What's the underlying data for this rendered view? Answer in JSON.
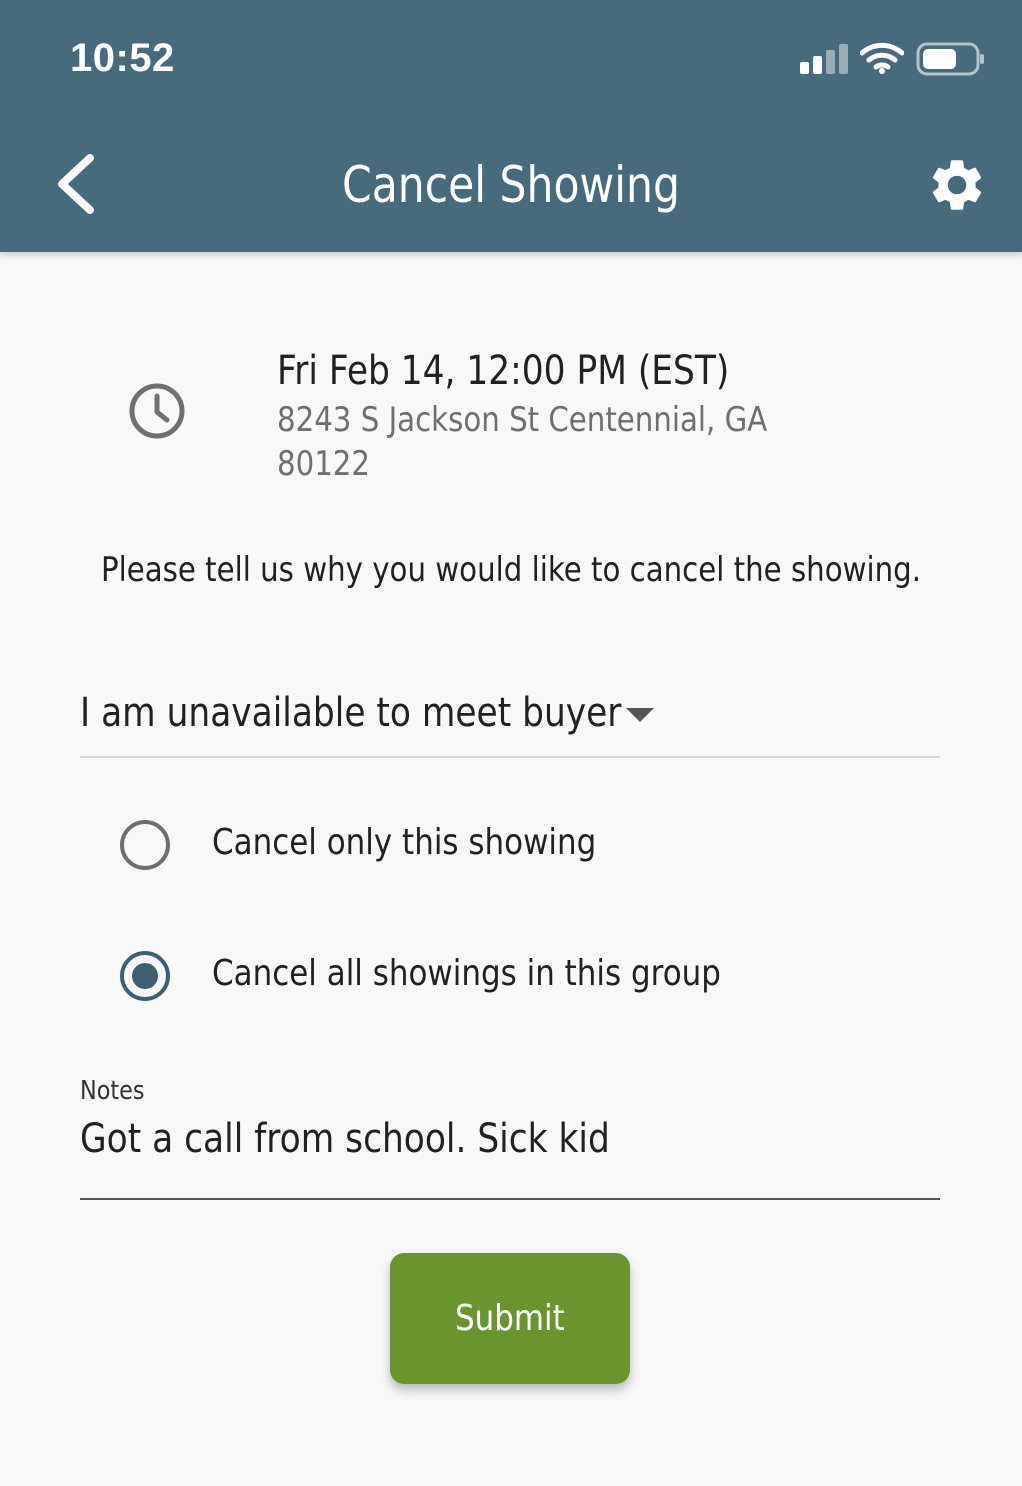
{
  "status_bar": {
    "time": "10:52"
  },
  "header": {
    "title": "Cancel Showing"
  },
  "showing": {
    "datetime": "Fri Feb 14, 12:00 PM (EST)",
    "address": "8243 S Jackson St  Centennial, GA 80122"
  },
  "prompt": "Please tell us why you would like to cancel the showing.",
  "reason_select": {
    "selected": "I am unavailable to meet buyer"
  },
  "options": [
    {
      "label": "Cancel only this showing",
      "checked": false
    },
    {
      "label": "Cancel all showings in this group",
      "checked": true
    }
  ],
  "notes": {
    "label": "Notes",
    "value": "Got a call from school. Sick kid"
  },
  "submit_label": "Submit",
  "colors": {
    "header": "#476a7c",
    "accent": "#3e5f72",
    "submit": "#6a952e"
  },
  "icons": [
    "back-chevron-icon",
    "gear-icon",
    "clock-icon",
    "caret-down-icon",
    "signal-icon",
    "wifi-icon",
    "battery-icon"
  ]
}
